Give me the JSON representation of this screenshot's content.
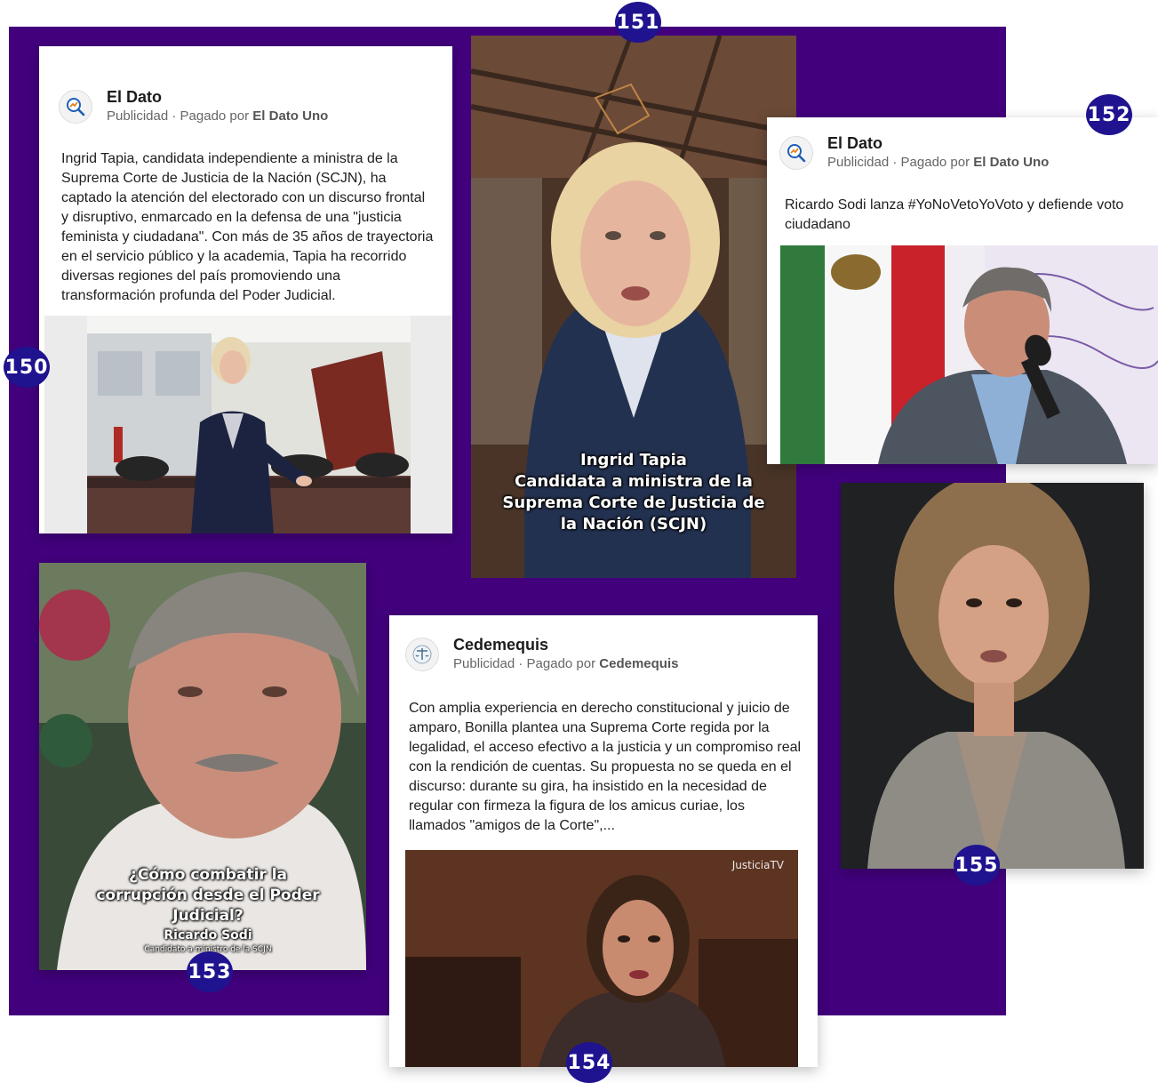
{
  "post_150": {
    "page_name": "El Dato",
    "sponsored_prefix": "Publicidad · Pagado por ",
    "payer": "El Dato Uno",
    "text": "Ingrid Tapia, candidata independiente a ministra de la Suprema Corte de Justicia de la Nación (SCJN), ha captado la atención del electorado con un discurso frontal y disruptivo, enmarcado en la defensa de una \"justicia feminista y ciudadana\". Con más de 35 años de trayectoria en el servicio público y la academia, Tapia ha recorrido diversas regiones del país promoviendo una transformación profunda del Poder Judicial.",
    "badge": "150"
  },
  "post_151": {
    "caption": "Ingrid Tapia\nCandidata a ministra de la\nSuprema Corte de Justicia de\nla Nación (SCJN)",
    "badge": "151"
  },
  "post_152": {
    "page_name": "El Dato",
    "sponsored_prefix": "Publicidad · Pagado por ",
    "payer": "El Dato Uno",
    "text": "Ricardo Sodi lanza #YoNoVetoYoVoto y defiende voto ciudadano",
    "badge": "152"
  },
  "post_153": {
    "question": "¿Cómo combatir la corrupción desde el Poder Judicial?",
    "name": "Ricardo Sodi",
    "role": "Candidato a ministro de la SCJN",
    "badge": "153"
  },
  "post_154": {
    "page_name": "Cedemequis",
    "sponsored_prefix": "Publicidad · Pagado por ",
    "payer": "Cedemequis",
    "text": "Con amplia experiencia en derecho constitucional y juicio de amparo, Bonilla plantea una Suprema Corte regida por la legalidad, el acceso efectivo a la justicia y un compromiso real con la rendición de cuentas. Su propuesta no se queda en el discurso: durante su gira, ha insistido en la necesidad de regular con firmeza la figura de los amicus curiae, los llamados \"amigos de la Corte\",...",
    "watermark": "JusticiaTV",
    "badge": "154"
  },
  "post_155": {
    "badge": "155"
  },
  "colors": {
    "background_panel": "#42007d",
    "badge": "#1f138f"
  }
}
